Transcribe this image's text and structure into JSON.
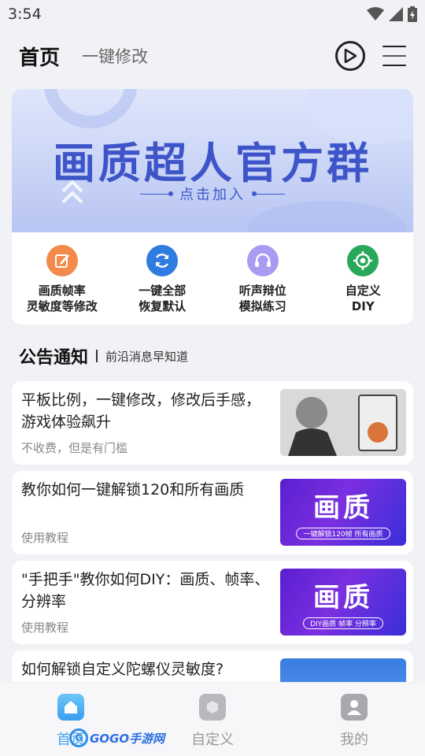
{
  "status": {
    "time": "3:54"
  },
  "header": {
    "title": "首页",
    "tab2": "一键修改"
  },
  "banner": {
    "headline": "画质超人官方群",
    "sub": "点击加入"
  },
  "quick": [
    {
      "label": "画质帧率\n灵敏度等修改",
      "icon": "edit-icon",
      "color": "#f28a4c"
    },
    {
      "label": "一键全部\n恢复默认",
      "icon": "refresh-icon",
      "color": "#2f7be0"
    },
    {
      "label": "听声辩位\n模拟练习",
      "icon": "headset-icon",
      "color": "#9a8bef"
    },
    {
      "label": "自定义\nDIY",
      "icon": "crosshair-icon",
      "color": "#2aa85a"
    }
  ],
  "announcements": {
    "title": "公告通知",
    "subtitle": "前沿消息早知道"
  },
  "news": [
    {
      "title": "平板比例，一键修改，修改后手感，游戏体验飙升",
      "tag": "不收费，但是有门槛",
      "thumb": "photo"
    },
    {
      "title": "教你如何一键解锁120和所有画质",
      "tag": "使用教程",
      "thumb_big": "画质",
      "thumb_small": "一键解锁120帧 所有画质"
    },
    {
      "title": "\"手把手\"教你如何DIY：画质、帧率、分辨率",
      "tag": "使用教程",
      "thumb_big": "画质",
      "thumb_small": "DIY画质 帧率 分辨率"
    },
    {
      "title": "如何解锁自定义陀螺仪灵敏度?",
      "tag": "",
      "thumb": "blue"
    }
  ],
  "nav": [
    {
      "label": "首页",
      "icon": "home-icon",
      "active": true
    },
    {
      "label": "自定义",
      "icon": "hexagon-icon",
      "active": false
    },
    {
      "label": "我的",
      "icon": "profile-icon",
      "active": false
    }
  ],
  "watermark": {
    "text": "GOGO手游网"
  }
}
